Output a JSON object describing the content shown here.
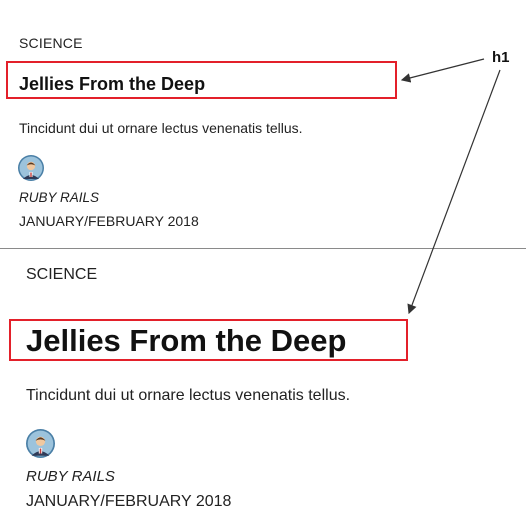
{
  "cards": [
    {
      "category": "SCIENCE",
      "title": "Jellies From the Deep",
      "description": "Tincidunt dui ut ornare lectus venenatis tellus.",
      "author": "RUBY RAILS",
      "date": "JANUARY/FEBRUARY 2018",
      "avatar_icon": "user-avatar-icon"
    },
    {
      "category": "SCIENCE",
      "title": "Jellies From the Deep",
      "description": "Tincidunt dui ut ornare lectus venenatis tellus.",
      "author": "RUBY RAILS",
      "date": "JANUARY/FEBRUARY 2018",
      "avatar_icon": "user-avatar-icon"
    }
  ],
  "annotation": {
    "label": "h1",
    "highlight_color": "#e3202a"
  }
}
